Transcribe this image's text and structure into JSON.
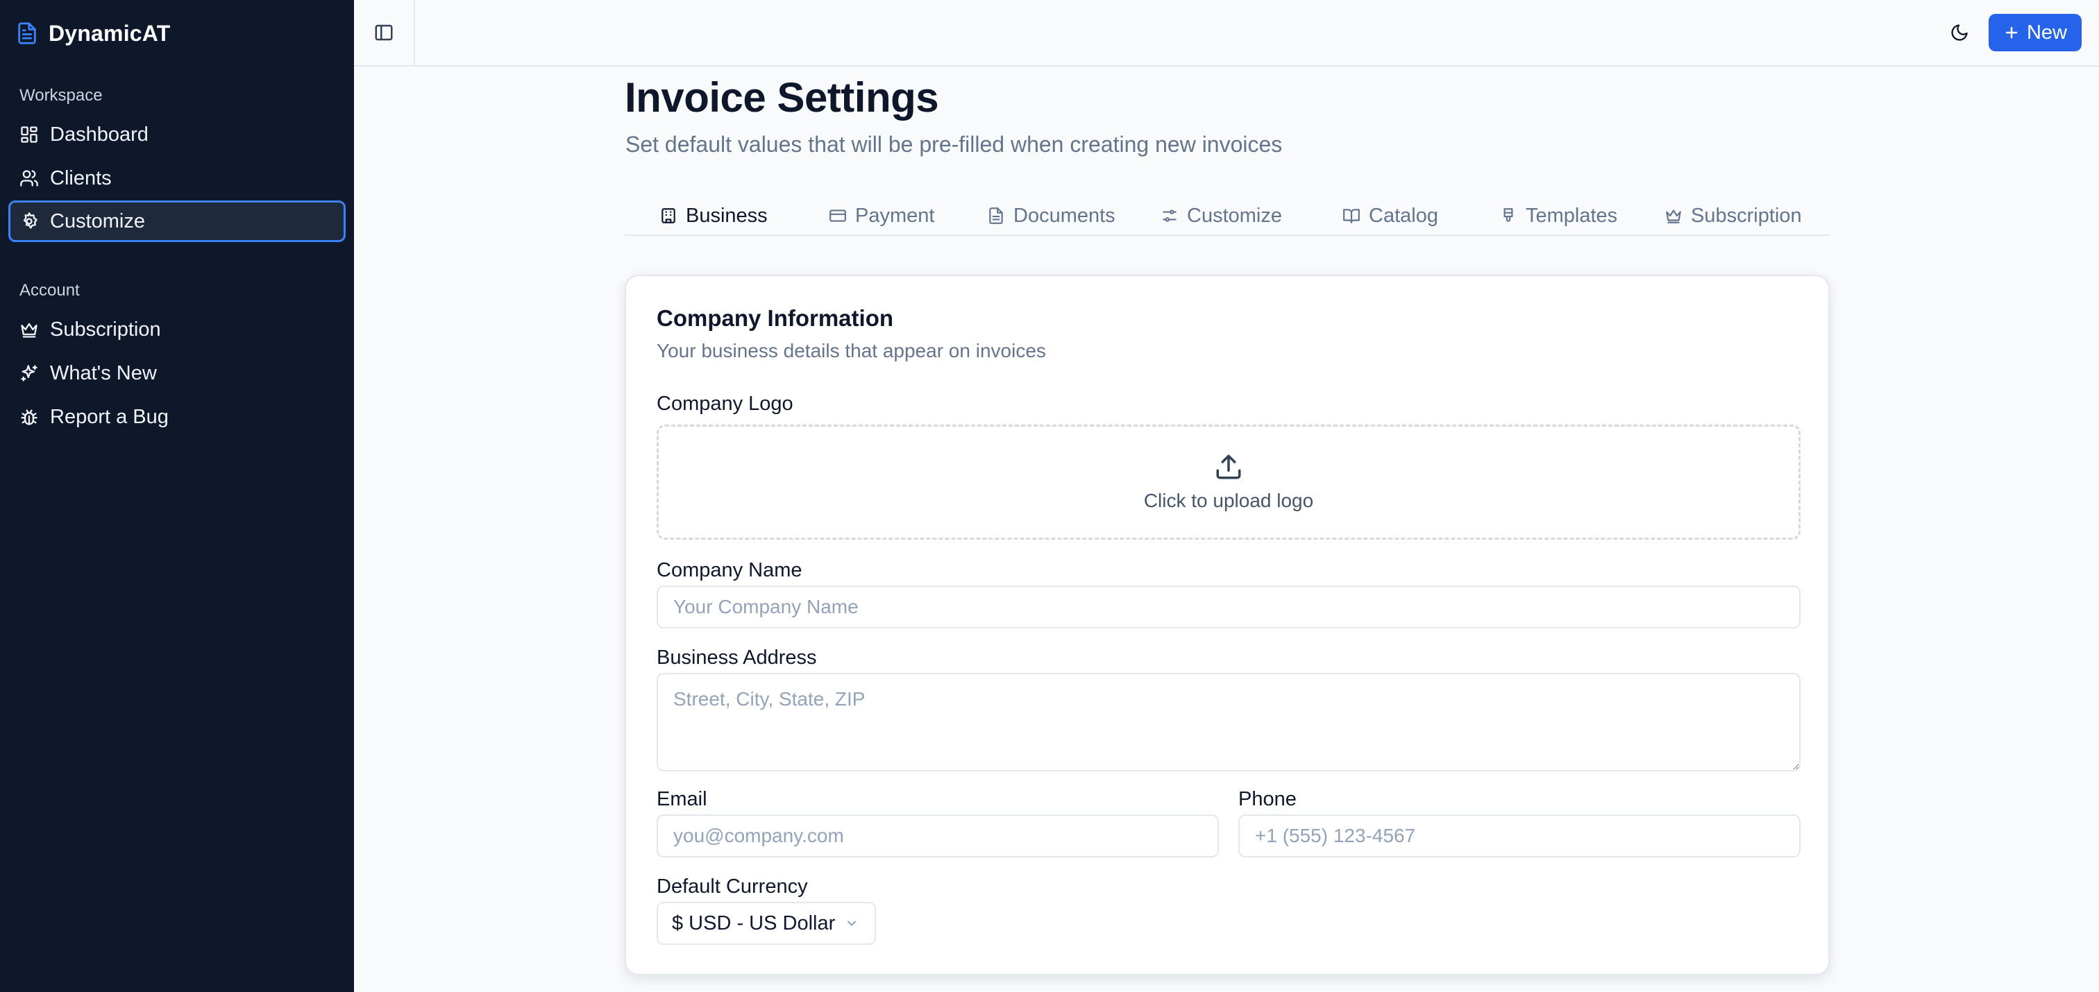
{
  "app": {
    "name": "DynamicAT",
    "accent": "#2563eb",
    "sidebar_bg": "#0f172a"
  },
  "sidebar": {
    "sections": [
      {
        "label": "Workspace",
        "items": [
          {
            "label": "Dashboard",
            "icon": "dashboard-icon"
          },
          {
            "label": "Clients",
            "icon": "users-icon"
          },
          {
            "label": "Customize",
            "icon": "gear-icon",
            "active": true
          }
        ]
      },
      {
        "label": "Account",
        "items": [
          {
            "label": "Subscription",
            "icon": "crown-icon"
          },
          {
            "label": "What's New",
            "icon": "sparkles-icon"
          },
          {
            "label": "Report a Bug",
            "icon": "bug-icon"
          }
        ]
      }
    ]
  },
  "topbar": {
    "toggle_icon": "sidebar-toggle-icon",
    "theme_icon": "moon-icon",
    "new_label": "New"
  },
  "page": {
    "title": "Invoice Settings",
    "subtitle": "Set default values that will be pre-filled when creating new invoices"
  },
  "tabs": [
    {
      "label": "Business",
      "icon": "building-icon",
      "active": true
    },
    {
      "label": "Payment",
      "icon": "credit-card-icon"
    },
    {
      "label": "Documents",
      "icon": "document-icon"
    },
    {
      "label": "Customize",
      "icon": "sliders-icon"
    },
    {
      "label": "Catalog",
      "icon": "book-icon"
    },
    {
      "label": "Templates",
      "icon": "stamp-icon"
    },
    {
      "label": "Subscription",
      "icon": "crown-icon"
    }
  ],
  "card": {
    "title": "Company Information",
    "description": "Your business details that appear on invoices",
    "logo": {
      "label": "Company Logo",
      "upload_text": "Click to upload logo"
    },
    "company_name": {
      "label": "Company Name",
      "placeholder": "Your Company Name",
      "value": ""
    },
    "address": {
      "label": "Business Address",
      "placeholder": "Street, City, State, ZIP",
      "value": ""
    },
    "email": {
      "label": "Email",
      "placeholder": "you@company.com",
      "value": ""
    },
    "phone": {
      "label": "Phone",
      "placeholder": "+1 (555) 123-4567",
      "value": ""
    },
    "currency": {
      "label": "Default Currency",
      "selected": "$ USD - US Dollar"
    }
  }
}
